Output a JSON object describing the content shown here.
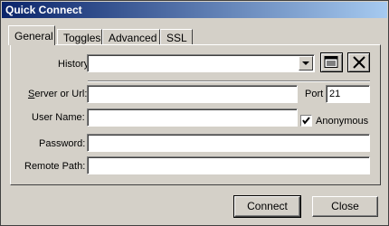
{
  "window": {
    "title": "Quick Connect"
  },
  "tabs": [
    {
      "label": "General",
      "active": true
    },
    {
      "label": "Toggles",
      "active": false
    },
    {
      "label": "Advanced",
      "active": false
    },
    {
      "label": "SSL",
      "active": false
    }
  ],
  "form": {
    "history": {
      "label": "History:",
      "value": ""
    },
    "server": {
      "label": "Server or Url:",
      "value": ""
    },
    "port": {
      "label": "Port",
      "value": "21"
    },
    "username": {
      "label": "User Name:",
      "value": ""
    },
    "anonymous": {
      "label": "Anonymous",
      "checked": true
    },
    "password": {
      "label": "Password:",
      "value": ""
    },
    "remote_path": {
      "label": "Remote Path:",
      "value": ""
    }
  },
  "buttons": {
    "connect": "Connect",
    "close": "Close"
  },
  "icons": {
    "history_list": "list-icon",
    "history_delete": "close-x-icon",
    "history_dropdown": "chevron-down-icon",
    "anonymous_check": "checkmark-icon"
  }
}
